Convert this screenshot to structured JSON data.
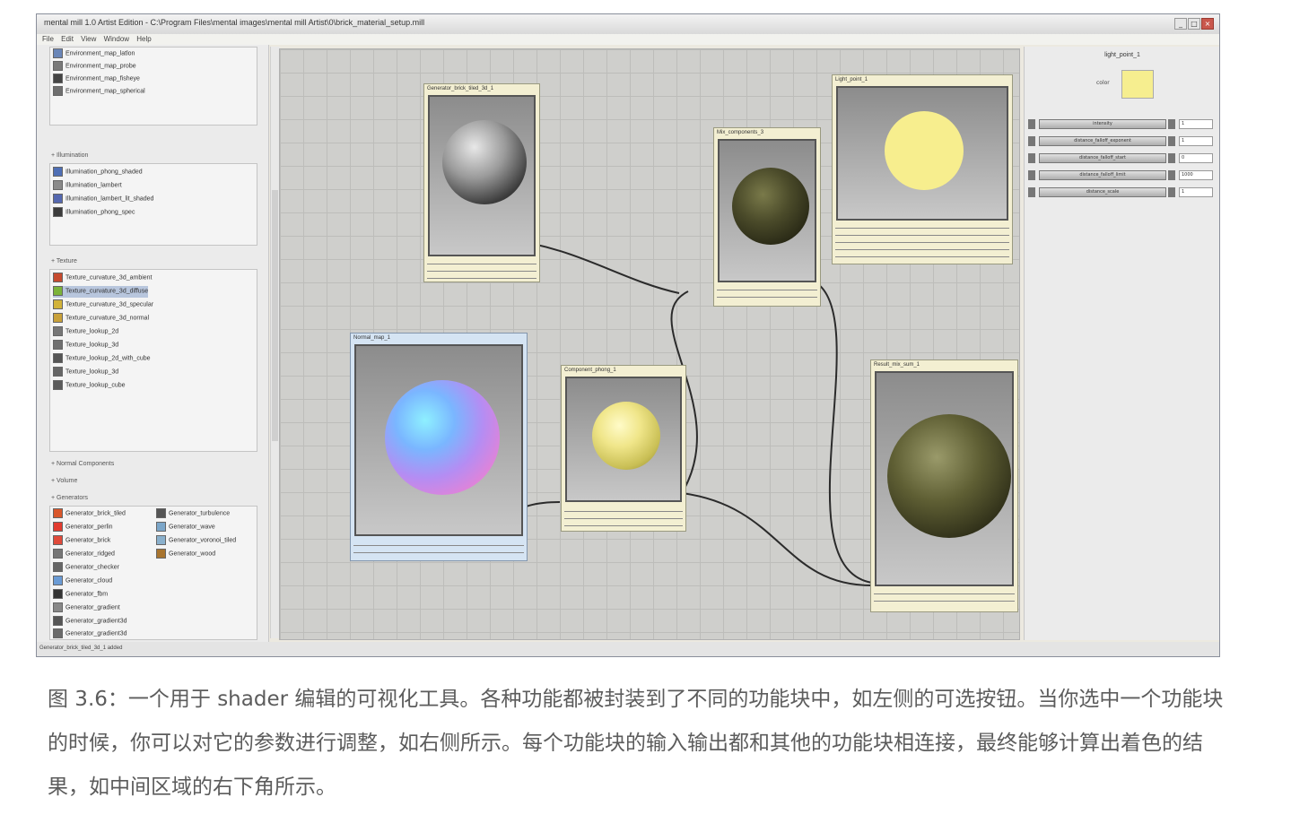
{
  "window": {
    "title": "mental mill 1.0 Artist Edition - C:\\Program Files\\mental images\\mental mill Artist\\0\\brick_material_setup.mill",
    "menu": [
      "File",
      "Edit",
      "View",
      "Window",
      "Help"
    ],
    "controls": [
      "_",
      "□",
      "×"
    ]
  },
  "sidebar": {
    "sections": [
      {
        "header": "",
        "items": [
          {
            "label": "Environment_map_latlon",
            "color": "#6a86b8"
          },
          {
            "label": "Environment_map_probe",
            "color": "#7a7a7a"
          },
          {
            "label": "Environment_map_fisheye",
            "color": "#444444"
          },
          {
            "label": "Environment_map_spherical",
            "color": "#6f6f6f"
          }
        ]
      },
      {
        "header": "+ Illumination",
        "items": [
          {
            "label": "Illumination_phong_shaded",
            "color": "#4f6fb5"
          },
          {
            "label": "Illumination_lambert",
            "color": "#8a8a8a"
          },
          {
            "label": "Illumination_lambert_lit_shaded",
            "color": "#5568b0"
          },
          {
            "label": "Illumination_phong_spec",
            "color": "#3b3b3b"
          }
        ]
      },
      {
        "header": "+ Texture",
        "items": [
          {
            "label": "Texture_curvature_3d_ambient",
            "color": "#c64a2e"
          },
          {
            "label": "Texture_curvature_3d_diffuse",
            "color": "#7cb33a"
          },
          {
            "label": "Texture_curvature_3d_specular",
            "color": "#d2b33a"
          },
          {
            "label": "Texture_curvature_3d_normal",
            "color": "#c9a13a"
          },
          {
            "label": "Texture_lookup_2d",
            "color": "#777777"
          },
          {
            "label": "Texture_lookup_3d",
            "color": "#6f6f6f"
          },
          {
            "label": "Texture_lookup_2d_with_cube",
            "color": "#555555"
          },
          {
            "label": "Texture_lookup_3d",
            "color": "#666666"
          },
          {
            "label": "Texture_lookup_cube",
            "color": "#5a5a5a"
          }
        ]
      },
      {
        "header": "+ Normal Components",
        "items": []
      },
      {
        "header": "+ Volume",
        "items": []
      },
      {
        "header": "+ Generators",
        "items_left": [
          {
            "label": "Generator_brick_tiled",
            "color": "#d9572b"
          },
          {
            "label": "Generator_perlin",
            "color": "#e23b2f"
          },
          {
            "label": "Generator_brick",
            "color": "#e04a3a"
          },
          {
            "label": "Generator_ridged",
            "color": "#777777"
          },
          {
            "label": "Generator_checker",
            "color": "#666666"
          },
          {
            "label": "Generator_cloud",
            "color": "#6a9bd5"
          },
          {
            "label": "Generator_fbm",
            "color": "#333333"
          },
          {
            "label": "Generator_gradient",
            "color": "#888888"
          },
          {
            "label": "Generator_gradient3d",
            "color": "#555555"
          },
          {
            "label": "Generator_gradient3d",
            "color": "#6a6a6a"
          }
        ],
        "items_right": [
          {
            "label": "Generator_turbulence",
            "color": "#555555"
          },
          {
            "label": "Generator_wave",
            "color": "#7ba6c9"
          },
          {
            "label": "Generator_voronoi_tiled",
            "color": "#8ab0cc"
          },
          {
            "label": "Generator_wood",
            "color": "#a8742e"
          }
        ]
      }
    ]
  },
  "nodes": {
    "brick_tiled": {
      "title": "Generator_brick_tiled_3d_1"
    },
    "normal_map": {
      "title": "Normal_map_1"
    },
    "phong": {
      "title": "Component_phong_1"
    },
    "mix_components": {
      "title": "Mix_components_3"
    },
    "light_point": {
      "title": "Light_point_1"
    },
    "result": {
      "title": "Result_mix_sum_1"
    }
  },
  "right_panel": {
    "title": "light_point_1",
    "color_label": "color",
    "color_value": "#f6ee8f",
    "params": [
      {
        "label": "intensity",
        "value": "1"
      },
      {
        "label": "distance_falloff_exponent",
        "value": "1"
      },
      {
        "label": "distance_falloff_start",
        "value": "0"
      },
      {
        "label": "distance_falloff_limit",
        "value": "1000"
      },
      {
        "label": "distance_scale",
        "value": "1"
      }
    ]
  },
  "status": "Generator_brick_tiled_3d_1 added",
  "caption": "图 3.6：一个用于 shader 编辑的可视化工具。各种功能都被封装到了不同的功能块中，如左侧的可选按钮。当你选中一个功能块的时候，你可以对它的参数进行调整，如右侧所示。每个功能块的输入输出都和其他的功能块相连接，最终能够计算出着色的结果，如中间区域的右下角所示。"
}
